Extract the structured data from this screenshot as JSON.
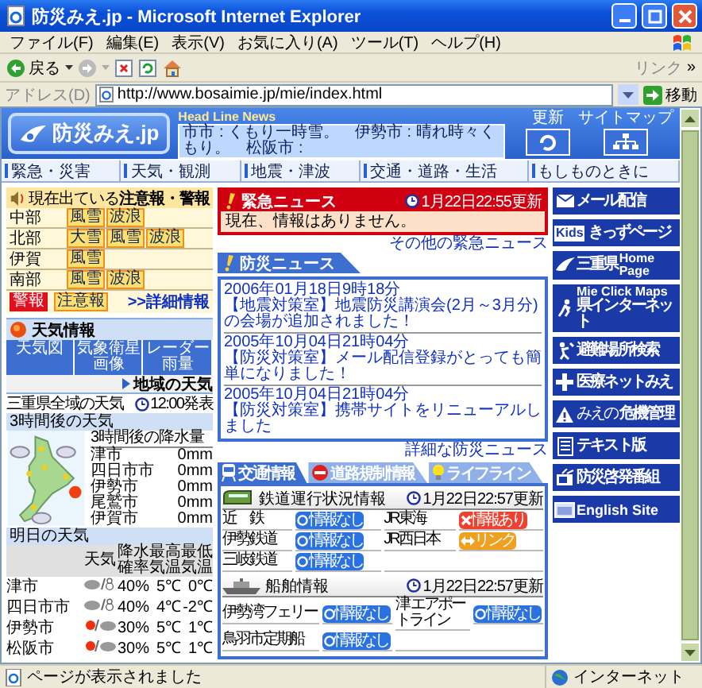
{
  "window": {
    "title": "防災みえ.jp - Microsoft Internet Explorer"
  },
  "menu": [
    "ファイル(F)",
    "編集(E)",
    "表示(V)",
    "お気に入り(A)",
    "ツール(T)",
    "ヘルプ(H)"
  ],
  "toolbar": {
    "back_label": "戻る",
    "links_label": "リンク",
    "chevron": "»"
  },
  "address": {
    "label": "アドレス(D)",
    "value": "http://www.bosaimie.jp/mie/index.html",
    "go_label": "移動"
  },
  "header": {
    "logo": "防災みえ.jp",
    "headline_title": "Head Line News",
    "headline": "市市 : くもり一時雪。　伊勢市 : 晴れ時々くもり。　松阪市 :",
    "refresh_label": "更新",
    "sitemap_label": "サイトマップ"
  },
  "nav": [
    "緊急・災害",
    "天気・観測",
    "地震・津波",
    "交通・道路・生活",
    "もしものときに"
  ],
  "warnings": {
    "title": "現在出ている**注意報・警報**",
    "regions": [
      {
        "name": "中部",
        "items": [
          {
            "label": "風雪",
            "kind": "advisory"
          },
          {
            "label": "波浪",
            "kind": "advisory"
          }
        ]
      },
      {
        "name": "北部",
        "items": [
          {
            "label": "大雪",
            "kind": "advisory"
          },
          {
            "label": "風雪",
            "kind": "advisory"
          },
          {
            "label": "波浪",
            "kind": "advisory"
          }
        ]
      },
      {
        "name": "伊賀",
        "items": [
          {
            "label": "風雪",
            "kind": "advisory"
          }
        ]
      },
      {
        "name": "南部",
        "items": [
          {
            "label": "風雪",
            "kind": "advisory"
          },
          {
            "label": "波浪",
            "kind": "advisory"
          }
        ]
      }
    ],
    "legend": [
      {
        "label": "警報",
        "kind": "warning"
      },
      {
        "label": "注意報",
        "kind": "advisory"
      }
    ],
    "detail_link": ">>詳細情報"
  },
  "weather": {
    "title": "天気情報",
    "tabs": [
      "天気図",
      "気象衛星画像",
      "レーダー雨量"
    ],
    "area_link": "地域の天気",
    "overall_label": "三重県全域の天気",
    "overall_time": "12:00発表",
    "three_hour_title": "3時間後の天気",
    "rain_title": "3時間後の降水量",
    "rain": [
      {
        "city": "津市",
        "value": "0mm"
      },
      {
        "city": "四日市市",
        "value": "0mm"
      },
      {
        "city": "伊勢市",
        "value": "0mm"
      },
      {
        "city": "尾鷲市",
        "value": "0mm"
      },
      {
        "city": "伊賀市",
        "value": "0mm"
      }
    ],
    "tomorrow_title": "明日の天気",
    "columns": [
      "天気",
      "降水確率",
      "最高気温",
      "最低気温"
    ],
    "tomorrow": [
      {
        "city": "津市",
        "kind": "cloud_snow",
        "rain": "40%",
        "high": "5℃",
        "low": "0℃"
      },
      {
        "city": "四日市市",
        "kind": "cloud_snow",
        "rain": "40%",
        "high": "4℃",
        "low": "-2℃"
      },
      {
        "city": "伊勢市",
        "kind": "sun_cloud",
        "rain": "30%",
        "high": "5℃",
        "low": "1℃"
      },
      {
        "city": "松阪市",
        "kind": "sun_cloud",
        "rain": "30%",
        "high": "5℃",
        "low": "1℃"
      }
    ]
  },
  "emergency": {
    "title": "緊急ニュース",
    "updated": "1月22日22:55更新",
    "message": "現在、情報はありません。",
    "more_link": "その他の緊急ニュース"
  },
  "disaster_news": {
    "title": "防災ニュース",
    "items": [
      {
        "date": "2006年01月18日9時18分",
        "text": "【地震対策室】地震防災講演会(2月～3月分)の会場が追加されました！"
      },
      {
        "date": "2005年10月04日21時04分",
        "text": "【防災対策室】メール配信登録がとっても簡単になりました！"
      },
      {
        "date": "2005年10月04日21時04分",
        "text": "【防災対策室】携帯サイトをリニューアルしました"
      }
    ],
    "more_link": "詳細な防災ニュース"
  },
  "traffic": {
    "tabs": [
      {
        "label": "交通情報",
        "kind": "train",
        "selected": true
      },
      {
        "label": "道路規制情報",
        "kind": "road",
        "selected": false
      },
      {
        "label": "ライフライン",
        "kind": "lifeline",
        "selected": false
      }
    ],
    "rail": {
      "title": "鉄道運行状況情報",
      "updated": "1月22日22:57更新",
      "items": [
        {
          "name": "近　鉄",
          "status": "情報なし",
          "kind": "none"
        },
        {
          "name": "JR東海",
          "status": "情報あり",
          "kind": "alert"
        },
        {
          "name": "伊勢鉄道",
          "status": "情報なし",
          "kind": "none"
        },
        {
          "name": "JR西日本",
          "status": "リンク",
          "kind": "link"
        },
        {
          "name": "三岐鉄道",
          "status": "情報なし",
          "kind": "none"
        }
      ]
    },
    "ship": {
      "title": "船舶情報",
      "updated": "1月22日22:57更新",
      "items": [
        {
          "name": "伊勢湾フェリー",
          "status": "情報なし",
          "kind": "none"
        },
        {
          "name": "津 エアポートライン",
          "status": "情報なし",
          "kind": "none"
        },
        {
          "name": "鳥羽市定期船",
          "status": "情報なし",
          "kind": "none"
        }
      ]
    }
  },
  "sidebar_links": [
    {
      "kind": "mail",
      "label": "メール配信"
    },
    {
      "kind": "kids",
      "badge": "Kids",
      "label": "きっずページ"
    },
    {
      "kind": "bird",
      "label": "三重県",
      "sub": "Home Page"
    },
    {
      "kind": "runner",
      "label": "Mie Click Maps",
      "sub": "県インターネット"
    },
    {
      "kind": "evacuee",
      "label": "避難場所検索"
    },
    {
      "kind": "cross",
      "label": "医療ネットみえ"
    },
    {
      "kind": "caution",
      "prefix": "みえの",
      "label": "危機管理"
    },
    {
      "kind": "document",
      "label": "テキスト版"
    },
    {
      "kind": "tv",
      "label": "防災啓発番組"
    },
    {
      "kind": "screen",
      "label": "English Site"
    }
  ],
  "status_bar": {
    "text": "ページが表示されました",
    "zone": "インターネット"
  }
}
